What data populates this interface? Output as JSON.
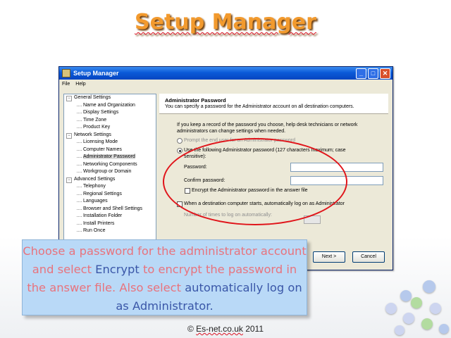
{
  "slide": {
    "title": "Setup Manager",
    "callout": {
      "p1": "Choose a password for the administrator account and select ",
      "p2": "Encrypt",
      "p3": " to encrypt the password in the answer file. Also select ",
      "p4": "automatically log on as Administrator",
      "p5": "."
    },
    "copyright_prefix": "© ",
    "copyright_brand": "Es-net.co.uk",
    "copyright_year": " 2011"
  },
  "window": {
    "title": "Setup Manager",
    "menu": [
      "File",
      "Help"
    ],
    "controls": {
      "min": "_",
      "max": "□",
      "close": "✕"
    }
  },
  "tree": {
    "groups": [
      {
        "label": "General Settings",
        "items": [
          "Name and Organization",
          "Display Settings",
          "Time Zone",
          "Product Key"
        ]
      },
      {
        "label": "Network Settings",
        "items": [
          "Licensing Mode",
          "Computer Names",
          "Administrator Password",
          "Networking Components",
          "Workgroup or Domain"
        ]
      },
      {
        "label": "Advanced Settings",
        "items": [
          "Telephony",
          "Regional Settings",
          "Languages",
          "Browser and Shell Settings",
          "Installation Folder",
          "Install Printers",
          "Run Once"
        ]
      }
    ],
    "selected": "Administrator Password"
  },
  "pane": {
    "heading": "Administrator Password",
    "subheading": "You can specify a password for the Administrator account on all destination computers.",
    "intro": "If you keep a record of the password you choose, help desk technicians or network administrators can change settings when needed.",
    "option_prompt": "Prompt the end user for an Administrator password",
    "option_use": "Use the following Administrator password (127 characters maximum; case sensitive):",
    "password_label": "Password:",
    "confirm_label": "Confirm password:",
    "encrypt_label": "Encrypt the Administrator password in the answer file",
    "autologon_label": "When a destination computer starts, automatically log on as Administrator",
    "times_label": "Number of times to log on automatically:",
    "next_button": "Next >",
    "cancel_button": "Cancel"
  },
  "colors": {
    "title": "#f29a2e",
    "callout_bg": "#b9d9f7",
    "callout_text": "#e8737d",
    "callout_highlight": "#3a57a8",
    "highlight_ring": "#e0141a"
  }
}
